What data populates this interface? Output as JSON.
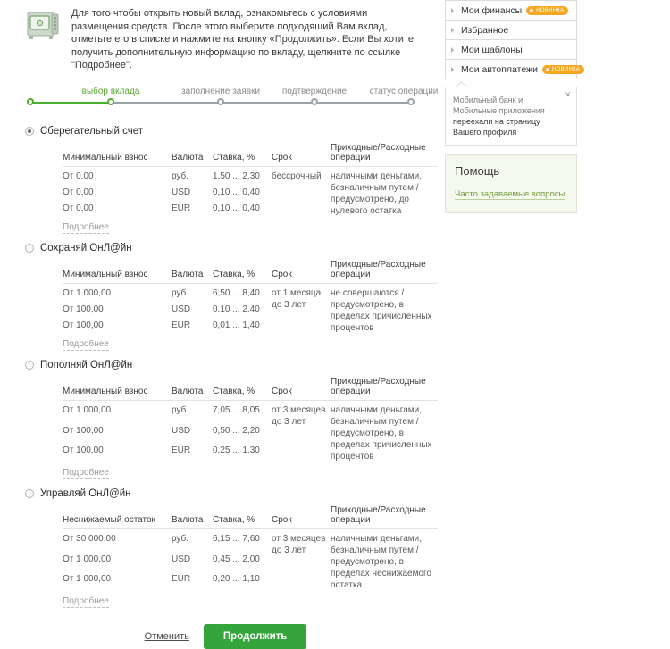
{
  "intro": {
    "icon": "safe-vault-icon",
    "text": "Для того чтобы открыть новый вклад, ознакомьтесь с условиями размещения средств. После этого выберите подходящий Вам вклад, отметьте его в списке и нажмите на кнопку «Продолжить». Если Вы хотите получить дополнительную информацию по вкладу, щелкните по ссылке \"Подробнее\"."
  },
  "stepper": {
    "active_index": 0,
    "steps": [
      {
        "label": "выбор вклада"
      },
      {
        "label": "заполнение заявки"
      },
      {
        "label": "подтверждение"
      },
      {
        "label": "статус операции"
      }
    ]
  },
  "table_headers": {
    "min": "Минимальный взнос",
    "min_alt": "Неснижаемый остаток",
    "currency": "Валюта",
    "rate": "Ставка, %",
    "term": "Срок",
    "ops": "Приходные/Расходные операции"
  },
  "more_label": "Подробнее",
  "deposits": [
    {
      "name": "Сберегательный счет",
      "selected": true,
      "min_header": "Минимальный взнос",
      "term": "бессрочный",
      "ops": "наличными деньгами, безналичным путем /  предусмотрено, до нулевого остатка",
      "rows": [
        {
          "min": "От 0,00",
          "currency": "руб.",
          "rate": "1,50 ... 2,30"
        },
        {
          "min": "От 0,00",
          "currency": "USD",
          "rate": "0,10 ... 0,40"
        },
        {
          "min": "От 0,00",
          "currency": "EUR",
          "rate": "0,10 ... 0,40"
        }
      ]
    },
    {
      "name": "Сохраняй ОнЛ@йн",
      "selected": false,
      "min_header": "Минимальный взнос",
      "term": "от 1 месяца до 3 лет",
      "ops": "не совершаются /  предусмотрено, в пределах причисленных процентов",
      "rows": [
        {
          "min": "От 1 000,00",
          "currency": "руб.",
          "rate": "6,50 ... 8,40"
        },
        {
          "min": "От 100,00",
          "currency": "USD",
          "rate": "0,10 ... 2,40"
        },
        {
          "min": "От 100,00",
          "currency": "EUR",
          "rate": "0,01 ... 1,40"
        }
      ]
    },
    {
      "name": "Пополняй ОнЛ@йн",
      "selected": false,
      "min_header": "Минимальный взнос",
      "term": "от 3 месяцев до 3 лет",
      "ops": "наличными деньгами, безналичным путем /  предусмотрено, в пределах причисленных процентов",
      "rows": [
        {
          "min": "От 1 000,00",
          "currency": "руб.",
          "rate": "7,05 ... 8,05"
        },
        {
          "min": "От 100,00",
          "currency": "USD",
          "rate": "0,50 ... 2,20"
        },
        {
          "min": "От 100,00",
          "currency": "EUR",
          "rate": "0,25 ... 1,30"
        }
      ]
    },
    {
      "name": "Управляй ОнЛ@йн",
      "selected": false,
      "min_header": "Неснижаемый остаток",
      "term": "от 3 месяцев до 3 лет",
      "ops": "наличными деньгами, безналичным путем /  предусмотрено, в пределах неснижаемого остатка",
      "rows": [
        {
          "min": "От 30 000,00",
          "currency": "руб.",
          "rate": "6,15 ... 7,60"
        },
        {
          "min": "От 1 000,00",
          "currency": "USD",
          "rate": "0,45 ... 2,00"
        },
        {
          "min": "От 1 000,00",
          "currency": "EUR",
          "rate": "0,20 ... 1,10"
        }
      ]
    }
  ],
  "actions": {
    "cancel_label": "Отменить",
    "continue_label": "Продолжить"
  },
  "sidebar": {
    "menu": [
      {
        "label": "Мои финансы",
        "badge": "НОВИНКА"
      },
      {
        "label": "Избранное",
        "badge": ""
      },
      {
        "label": "Мои шаблоны",
        "badge": ""
      },
      {
        "label": "Мои автоплатежи",
        "badge": "НОВИНКА"
      }
    ],
    "notice": {
      "part1": "Мобильный банк",
      "part2": " и ",
      "part3": "Мобильные приложения",
      "part4": " переехали на страницу Вашего профиля",
      "close": "✕"
    },
    "help": {
      "title": "Помощь",
      "link": "Часто задаваемые вопросы"
    }
  },
  "colors": {
    "accent_green": "#34a53a",
    "step_green": "#4caf2e",
    "badge_orange": "#f5a623",
    "help_bg": "#f5f8ed"
  }
}
